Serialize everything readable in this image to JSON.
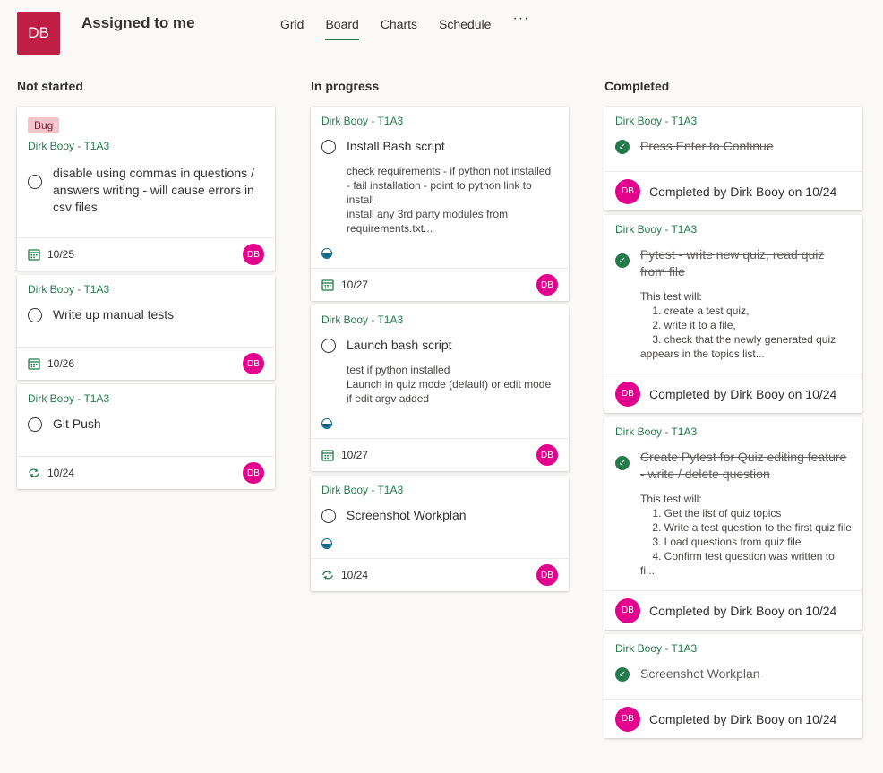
{
  "header": {
    "plan_initials": "DB",
    "title": "Assigned to me",
    "tabs": [
      "Grid",
      "Board",
      "Charts",
      "Schedule"
    ],
    "more_label": "···"
  },
  "columns": [
    {
      "title": "Not started",
      "cards": [
        {
          "label": "Bug",
          "bucket": "Dirk Booy - T1A3",
          "title": "disable using commas in questions / answers writing - will cause errors in csv files",
          "date": "10/25",
          "avatar": "DB"
        },
        {
          "bucket": "Dirk Booy - T1A3",
          "title": "Write up manual tests",
          "date": "10/26",
          "avatar": "DB"
        },
        {
          "bucket": "Dirk Booy - T1A3",
          "title": "Git Push",
          "date": "10/24",
          "avatar": "DB"
        }
      ]
    },
    {
      "title": "In progress",
      "cards": [
        {
          "bucket": "Dirk Booy - T1A3",
          "title": "Install Bash script",
          "notes": "check requirements - if python not installed - fail installation - point to python link to install\ninstall any 3rd party modules from requirements.txt...",
          "date": "10/27",
          "avatar": "DB"
        },
        {
          "bucket": "Dirk Booy - T1A3",
          "title": "Launch bash script",
          "notes": "test if python installed\nLaunch in quiz mode (default) or edit mode if edit argv added",
          "date": "10/27",
          "avatar": "DB"
        },
        {
          "bucket": "Dirk Booy - T1A3",
          "title": "Screenshot Workplan",
          "date": "10/24",
          "avatar": "DB"
        }
      ]
    },
    {
      "title": "Completed",
      "cards": [
        {
          "bucket": "Dirk Booy - T1A3",
          "title": "Press Enter to Continue",
          "completed": "Completed by Dirk Booy on 10/24",
          "avatar": "DB"
        },
        {
          "bucket": "Dirk Booy - T1A3",
          "title": "Pytest - write new quiz, read quiz from file",
          "notes": "This test will:\n    1. create a test quiz,\n    2. write it to a file,\n    3. check that the newly generated quiz appears in the topics list...",
          "completed": "Completed by Dirk Booy on 10/24",
          "avatar": "DB"
        },
        {
          "bucket": "Dirk Booy - T1A3",
          "title": "Create Pytest for Quiz editing feature - write / delete question",
          "notes": "This test will:\n    1. Get the list of quiz topics\n    2. Write a test question to the first quiz file\n    3. Load questions from quiz file\n    4. Confirm test question was written to fi...",
          "completed": "Completed by Dirk Booy on 10/24",
          "avatar": "DB"
        },
        {
          "bucket": "Dirk Booy - T1A3",
          "title": "Screenshot Workplan",
          "completed": "Completed by Dirk Booy on 10/24",
          "avatar": "DB"
        }
      ]
    }
  ]
}
